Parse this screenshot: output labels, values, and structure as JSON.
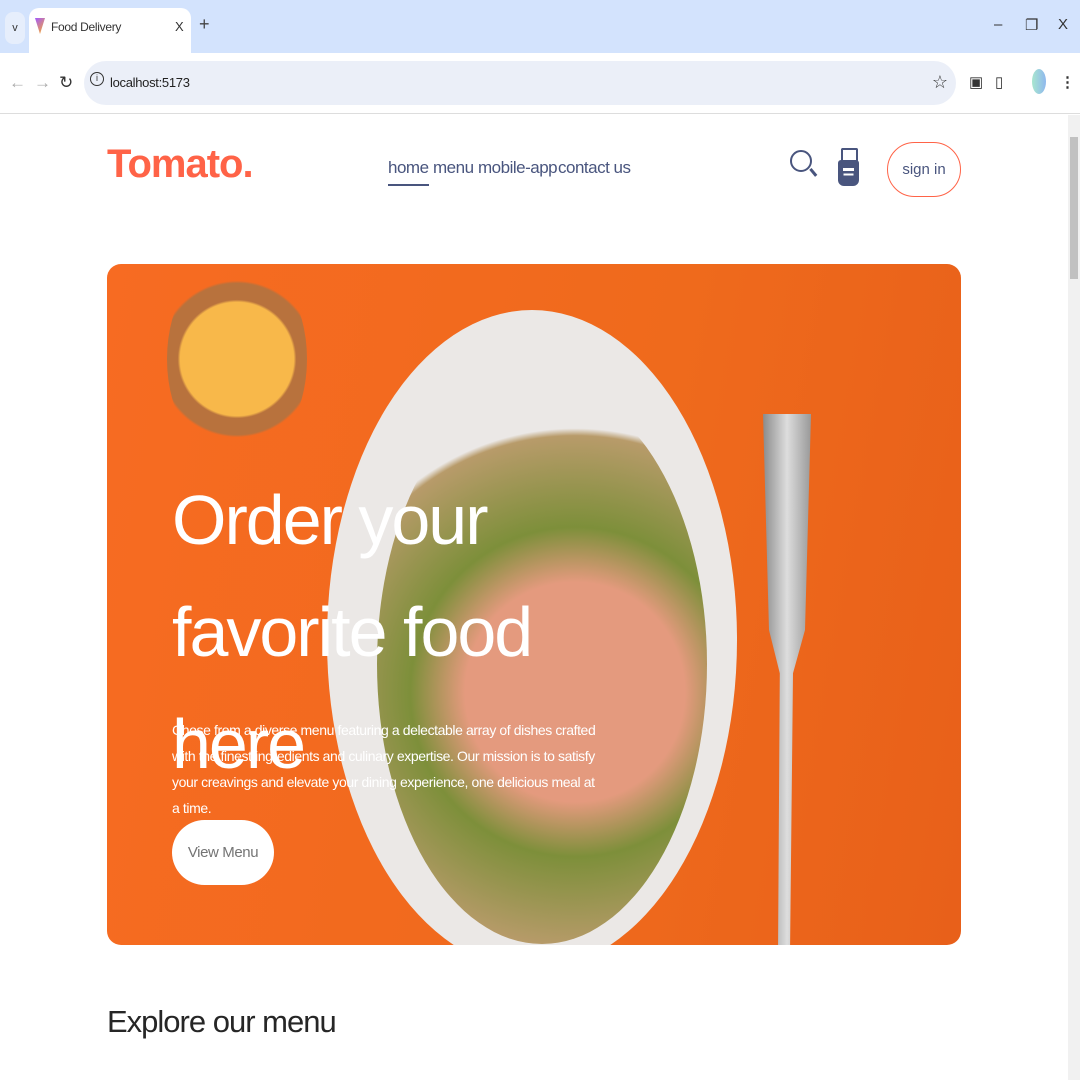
{
  "browser": {
    "tab_title": "Food Delivery",
    "url": "localhost:5173",
    "win_min": "–",
    "win_restore": "❐",
    "win_close": "X",
    "new_tab": "+",
    "tab_close": "X",
    "tab_list": "v"
  },
  "header": {
    "logo": "Tomato.",
    "nav": [
      "home",
      "menu",
      "mobile-app",
      "contact us"
    ],
    "active": "home",
    "sign_in": "sign in"
  },
  "hero": {
    "title": "Order your favorite food here",
    "description": "Chose from a diverse menu featuring a delectable array of dishes crafted with the finest ingredients and culinary expertise. Our mission is to satisfy your creavings and elevate your dining experience, one delicious meal at a time.",
    "button": "View Menu"
  },
  "explore": {
    "title": "Explore our menu"
  },
  "colors": {
    "accent": "#ff6347",
    "nav_text": "#49557e",
    "hero_bg": "#f26b1f"
  }
}
